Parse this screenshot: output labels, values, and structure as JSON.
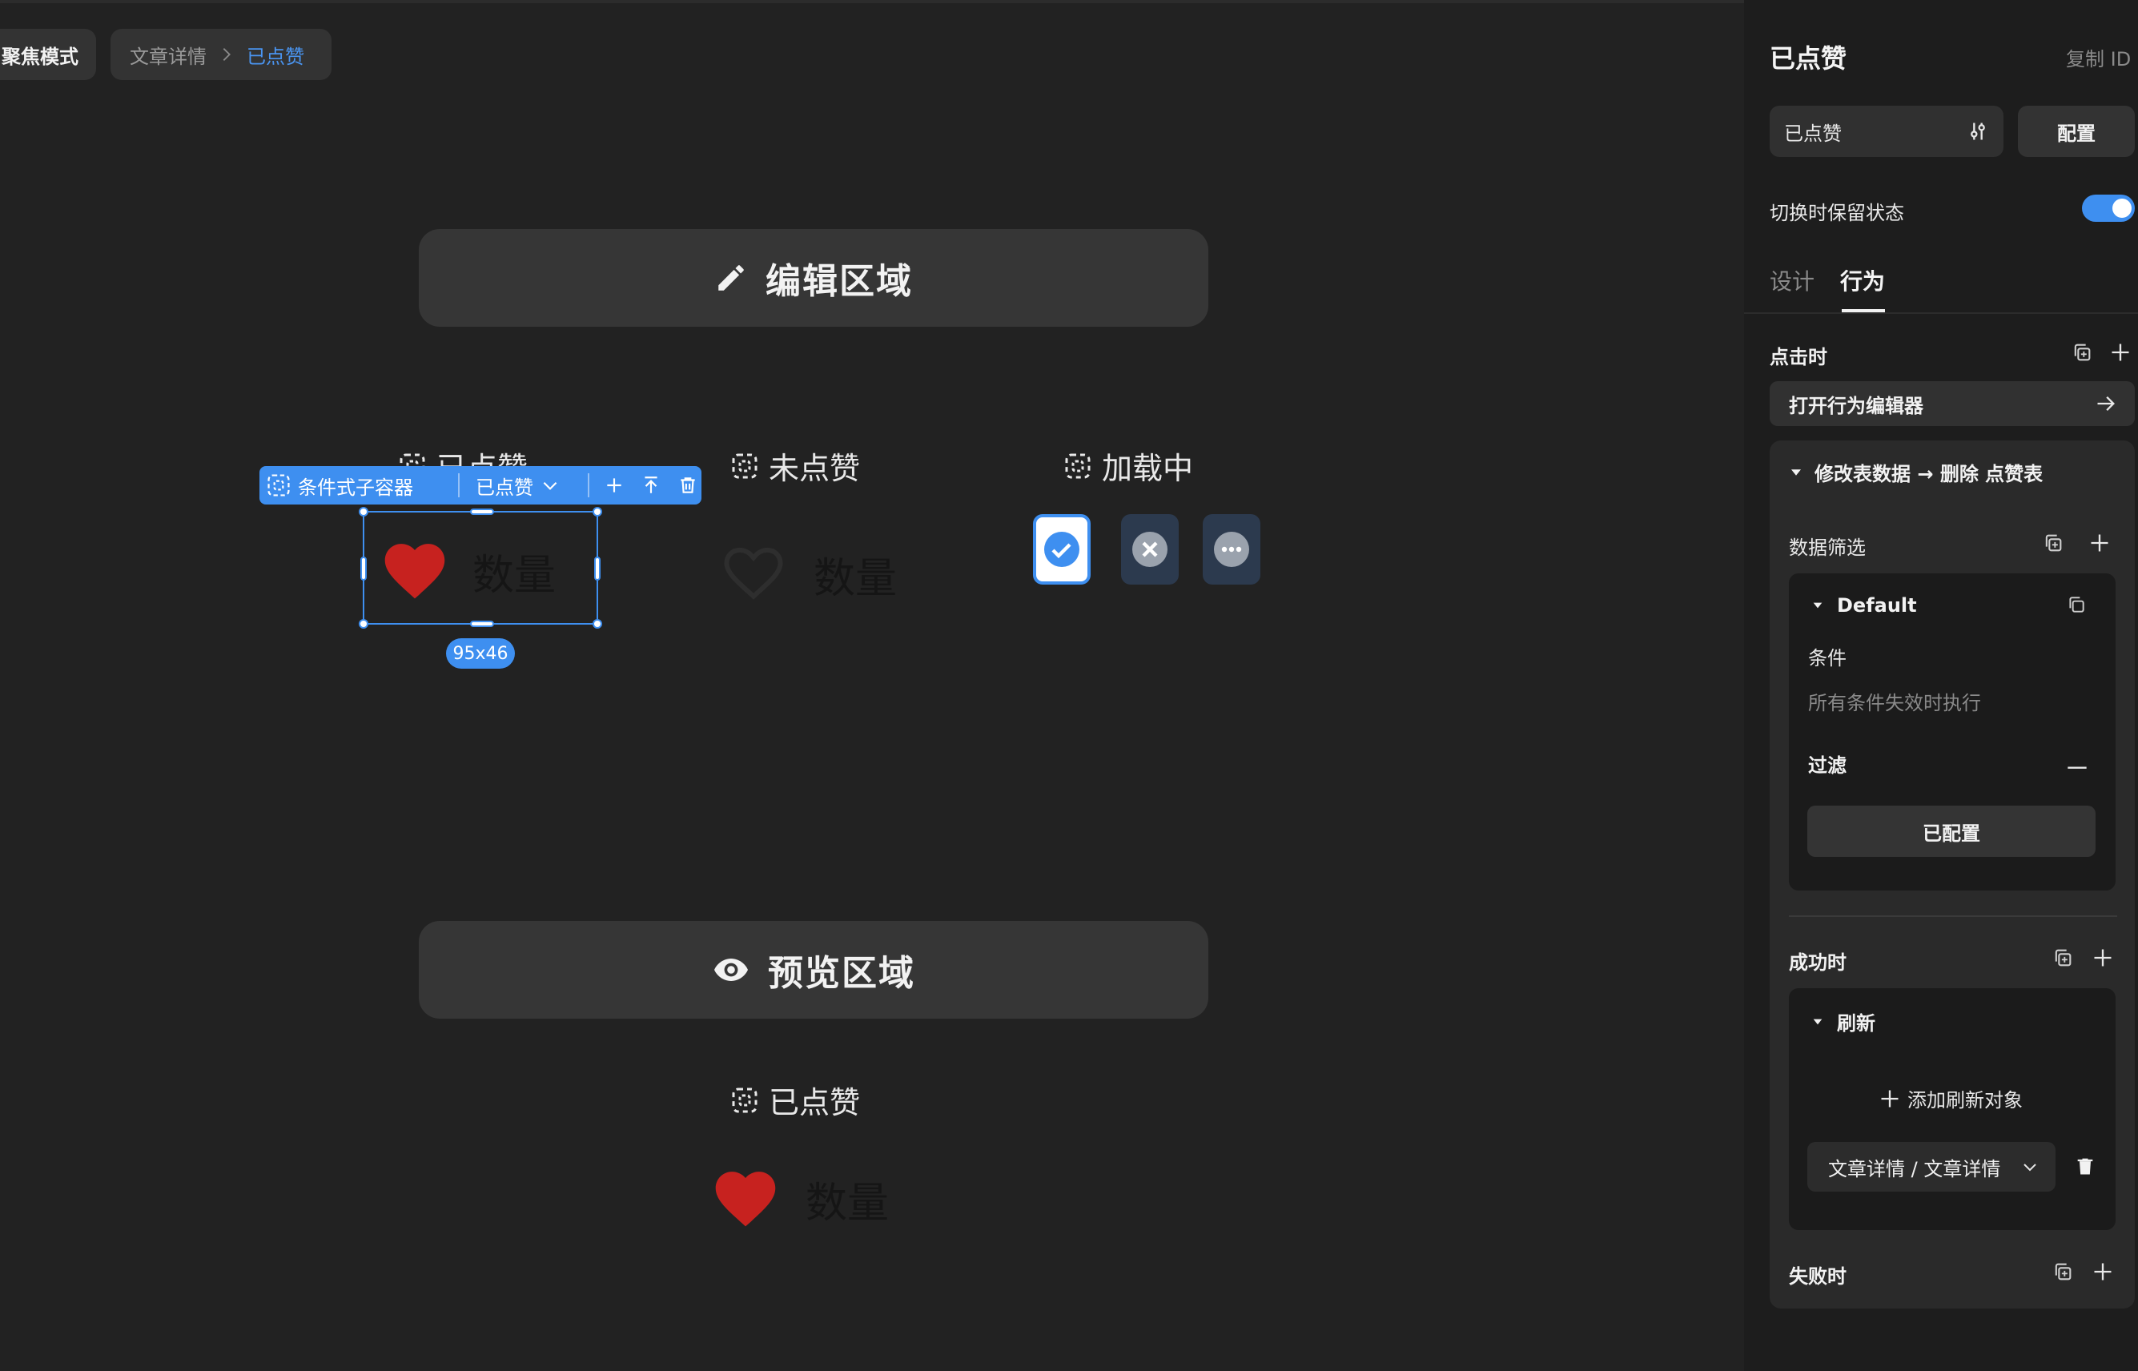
{
  "breadcrumb": {
    "focus_mode": "聚焦模式",
    "page": "文章详情",
    "current": "已点赞"
  },
  "canvas": {
    "edit_region_label": "编辑区域",
    "preview_region_label": "预览区域",
    "states": {
      "liked": "已点赞",
      "not_liked": "未点赞",
      "loading": "加载中"
    },
    "count_label": "数量",
    "selection_size": "95x46",
    "toolbar": {
      "container_label": "条件式子容器",
      "state_select": "已点赞"
    },
    "preview_state_label": "已点赞",
    "preview_count_label": "数量"
  },
  "colors": {
    "accent": "#3e8ff0",
    "heart": "#c7221f",
    "background": "#222222",
    "panel": "#1d1d1d"
  },
  "panel": {
    "title": "已点赞",
    "copy_id": "复制 ID",
    "state_select_value": "已点赞",
    "configure_button": "配置",
    "keep_state_label": "切换时保留状态",
    "keep_state_on": true,
    "tabs": [
      {
        "label": "设计",
        "active": false
      },
      {
        "label": "行为",
        "active": true
      }
    ],
    "on_click": {
      "title": "点击时",
      "open_editor": "打开行为编辑器",
      "action": {
        "title": "修改表数据 → 删除 点赞表",
        "data_filter": {
          "title": "数据筛选",
          "default_block": {
            "title": "Default",
            "condition_label": "条件",
            "condition_hint": "所有条件失效时执行",
            "filter_label": "过滤",
            "filter_value": "已配置"
          }
        }
      },
      "on_success": {
        "title": "成功时",
        "refresh": {
          "title": "刷新",
          "add_target": "添加刷新对象",
          "target": "文章详情 / 文章详情"
        }
      },
      "on_fail": {
        "title": "失败时"
      }
    }
  }
}
